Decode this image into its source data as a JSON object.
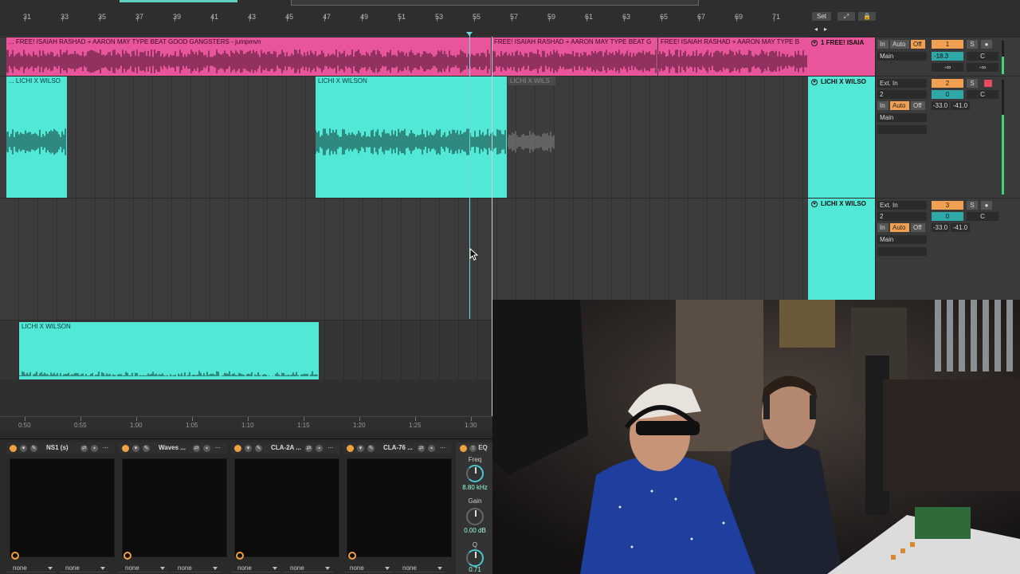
{
  "ruler": {
    "bars": [
      "31",
      "33",
      "35",
      "37",
      "39",
      "41",
      "43",
      "45",
      "47",
      "49",
      "51",
      "53",
      "55",
      "57",
      "59",
      "61",
      "63",
      "65",
      "67",
      "69",
      "71"
    ],
    "set_label": "Set"
  },
  "tracks": [
    {
      "header_name": "1 FREE! ISAIA",
      "clips": [
        "... FREE! ISAIAH RASHAD + AARON MAY TYPE BEAT GOOD GANGSTERS - jumpmvn",
        "FREE! ISAIAH RASHAD + AARON MAY TYPE BEAT G",
        "FREE! ISAIAH RASHAD + AARON MAY TYPE B"
      ],
      "mixer": {
        "in": "In",
        "auto": "Auto",
        "off": "Off",
        "number": "1",
        "solo": "S",
        "output": "Main",
        "volume": "-18.3",
        "pan": "C",
        "inf_left": "-∞",
        "inf_right": "-∞"
      }
    },
    {
      "header_name": "LICHI X WILSO",
      "clips": [
        "... LICHI X WILSO",
        "LICHI X WILSON",
        "LICHI X WILS"
      ],
      "mixer": {
        "input": "Ext. In",
        "channel": "2",
        "number": "2",
        "solo": "S",
        "volume": "0",
        "pan": "C",
        "in": "In",
        "auto": "Auto",
        "off": "Off",
        "send_a": "-33.0",
        "send_b": "-41.0",
        "output": "Main"
      }
    },
    {
      "header_name": "LICHI X WILSO",
      "clips": [],
      "mixer": {
        "input": "Ext. In",
        "channel": "2",
        "number": "3",
        "solo": "S",
        "volume": "0",
        "pan": "C",
        "in": "In",
        "auto": "Auto",
        "off": "Off",
        "send_a": "-33.0",
        "send_b": "-41.0",
        "output": "Main"
      }
    },
    {
      "header_name": "",
      "clips": [
        "LICHI X WILSON"
      ]
    }
  ],
  "timeline": {
    "labels": [
      "0:50",
      "0:55",
      "1:00",
      "1:05",
      "1:10",
      "1:15",
      "1:20",
      "1:25",
      "1:30"
    ]
  },
  "devices": [
    {
      "name": "NS1 (s)",
      "sel_a": "none",
      "sel_b": "none"
    },
    {
      "name": "Waves ...",
      "sel_a": "none",
      "sel_b": "none"
    },
    {
      "name": "CLA-2A ...",
      "sel_a": "none",
      "sel_b": "none"
    },
    {
      "name": "CLA-76 ...",
      "sel_a": "none",
      "sel_b": "none"
    }
  ],
  "eq": {
    "title": "EQ",
    "freq_label": "Freq",
    "freq_value": "8.80 kHz",
    "gain_label": "Gain",
    "gain_value": "0.00 dB",
    "q_label": "Q",
    "q_value": "0.71"
  },
  "colors": {
    "pink": "#e8559b",
    "teal": "#52e8d6",
    "orange": "#f0a050",
    "record": "#e84a60"
  }
}
